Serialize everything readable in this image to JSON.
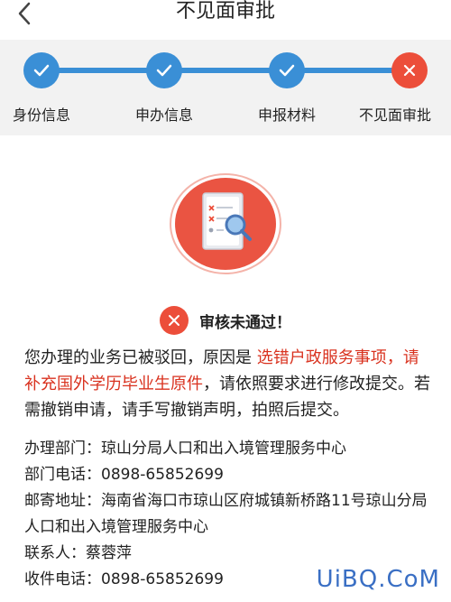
{
  "navbar": {
    "title": "不见面审批"
  },
  "steps": [
    {
      "label": "身份信息",
      "state": "done"
    },
    {
      "label": "申办信息",
      "state": "done"
    },
    {
      "label": "申报材料",
      "state": "done"
    },
    {
      "label": "不见面审批",
      "state": "fail"
    }
  ],
  "colors": {
    "primary": "#3a8fd6",
    "danger": "#ec4e3a",
    "highlight": "#d9321f",
    "panel_bg": "#f2f2f2"
  },
  "result": {
    "text": "审核未通过！"
  },
  "reason": {
    "prefix": "您办理的业务已被驳回，原因是 ",
    "highlight": "选错户政服务事项，请补充国外学历毕业生原件",
    "suffix": "，请依照要求进行修改提交。若需撤销申请，请手写撤销声明，拍照后提交。"
  },
  "contact": {
    "department": {
      "label": "办理部门：",
      "value": "琼山分局人口和出入境管理服务中心"
    },
    "dept_phone": {
      "label": "部门电话：",
      "value": "0898-65852699"
    },
    "address": {
      "label": "邮寄地址：",
      "value": "海南省海口市琼山区府城镇新桥路11号琼山分局人口和出入境管理服务中心"
    },
    "contact_person": {
      "label": "联系人：",
      "value": "蔡蓉萍"
    },
    "receive_phone": {
      "label": "收件电话：",
      "value": "0898-65852699"
    }
  },
  "watermark": "UiBQ.CoM"
}
